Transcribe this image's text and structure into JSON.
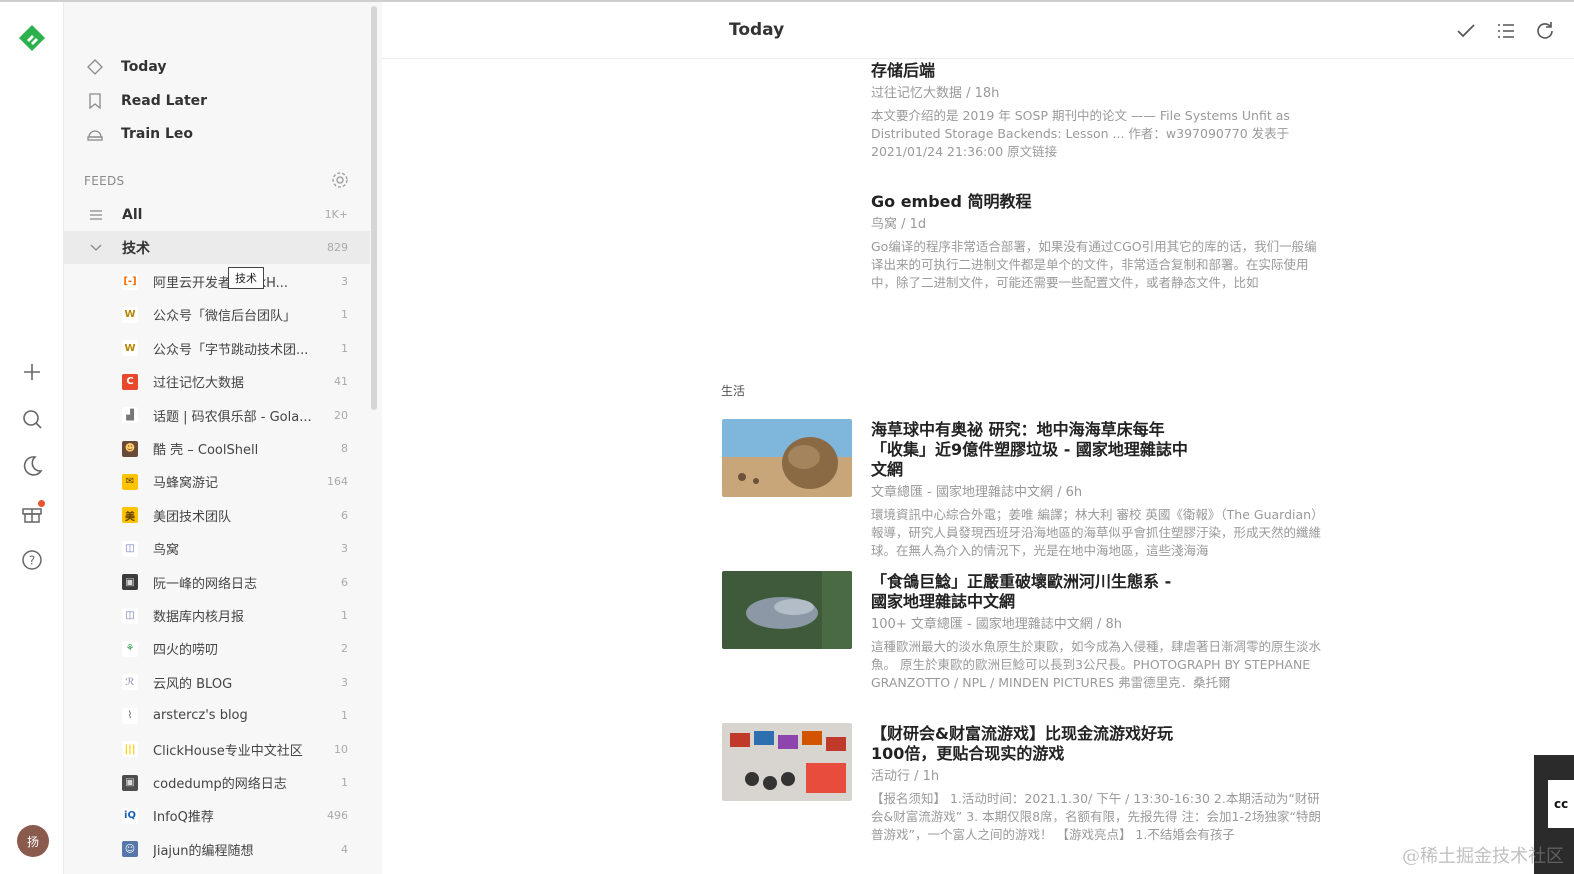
{
  "app": {
    "avatar_text": "扬"
  },
  "sidebar": {
    "nav": [
      {
        "label": "Today",
        "icon": "today-icon"
      },
      {
        "label": "Read Later",
        "icon": "bookmark-icon"
      },
      {
        "label": "Train Leo",
        "icon": "leo-icon"
      }
    ],
    "feeds_heading": "FEEDS",
    "all": {
      "label": "All",
      "count": "1K+"
    },
    "category": {
      "label": "技术",
      "count": "829"
    },
    "tooltip": "技术",
    "feeds": [
      {
        "label": "阿里云开发者 ClickH...",
        "count": "3",
        "icon_text": "[-]",
        "icon_bg": "#ffffff",
        "icon_fg": "#ff6a00"
      },
      {
        "label": "公众号「微信后台团队」",
        "count": "1",
        "icon_text": "W",
        "icon_bg": "#ffffff",
        "icon_fg": "#b38600"
      },
      {
        "label": "公众号「字节跳动技术团...",
        "count": "1",
        "icon_text": "W",
        "icon_bg": "#ffffff",
        "icon_fg": "#b38600"
      },
      {
        "label": "过往记忆大数据",
        "count": "41",
        "icon_text": "C",
        "icon_bg": "#e8482b",
        "icon_fg": "#ffffff"
      },
      {
        "label": "话题 | 码农俱乐部 - Gola...",
        "count": "20",
        "icon_text": "▟",
        "icon_bg": "#ffffff",
        "icon_fg": "#777777"
      },
      {
        "label": "酷 壳 – CoolShell",
        "count": "8",
        "icon_text": "☻",
        "icon_bg": "#6b4a3a",
        "icon_fg": "#ffcc66"
      },
      {
        "label": "马蜂窝游记",
        "count": "164",
        "icon_text": "✉",
        "icon_bg": "#ffc300",
        "icon_fg": "#5a3b00"
      },
      {
        "label": "美团技术团队",
        "count": "6",
        "icon_text": "美",
        "icon_bg": "#ffc300",
        "icon_fg": "#5a3b00"
      },
      {
        "label": "鸟窝",
        "count": "3",
        "icon_text": "◫",
        "icon_bg": "#ffffff",
        "icon_fg": "#6c7ab8"
      },
      {
        "label": "阮一峰的网络日志",
        "count": "6",
        "icon_text": "▣",
        "icon_bg": "#3b3b3b",
        "icon_fg": "#d9d9d9"
      },
      {
        "label": "数据库内核月报",
        "count": "1",
        "icon_text": "◫",
        "icon_bg": "#ffffff",
        "icon_fg": "#6c7ab8"
      },
      {
        "label": "四火的唠叨",
        "count": "2",
        "icon_text": "⚘",
        "icon_bg": "#ffffff",
        "icon_fg": "#2e9a4a"
      },
      {
        "label": "云风的 BLOG",
        "count": "3",
        "icon_text": "ℛ",
        "icon_bg": "#ffffff",
        "icon_fg": "#a0a8b8"
      },
      {
        "label": "arstercz's blog",
        "count": "1",
        "icon_text": "⌇",
        "icon_bg": "#ffffff",
        "icon_fg": "#888888"
      },
      {
        "label": "ClickHouse专业中文社区",
        "count": "10",
        "icon_text": "|||",
        "icon_bg": "#ffffff",
        "icon_fg": "#ffcc00"
      },
      {
        "label": "codedump的网络日志",
        "count": "1",
        "icon_text": "▣",
        "icon_bg": "#4d4d4d",
        "icon_fg": "#d9d9d9"
      },
      {
        "label": "InfoQ推荐",
        "count": "496",
        "icon_text": "iQ",
        "icon_bg": "#ffffff",
        "icon_fg": "#1b5fb0"
      },
      {
        "label": "Jiajun的编程随想",
        "count": "4",
        "icon_text": "☺",
        "icon_bg": "#5577aa",
        "icon_fg": "#ffffff"
      }
    ]
  },
  "main": {
    "title": "Today",
    "section_life": "生活",
    "articles": [
      {
        "title": "存储后端",
        "meta": "过往记忆大数据 / 18h",
        "snippet": "本文要介绍的是 2019 年 SOSP 期刊中的论文 —— File Systems Unfit as Distributed Storage Backends: Lesson ... 作者：w397090770 发表于 2021/01/24 21:36:00 原文链接"
      },
      {
        "title": "Go embed 简明教程",
        "meta": "鸟窝 / 1d",
        "snippet": "Go编译的程序非常适合部署，如果没有通过CGO引用其它的库的话，我们一般编译出来的可执行二进制文件都是单个的文件，非常适合复制和部署。在实际使用中，除了二进制文件，可能还需要一些配置文件，或者静态文件，比如"
      },
      {
        "title": "海草球中有奥祕 研究：地中海海草床每年「收集」近9億件塑膠垃圾 - 國家地理雜誌中文網",
        "meta": "文章總匯 - 國家地理雜誌中文網 / 6h",
        "snippet": "環境資訊中心綜合外電；姜唯 編譯；林大利 審校 英國《衛報》（The Guardian）報導，研究人員發現西班牙沿海地區的海草似乎會抓住塑膠汙染，形成天然的纖維球。在無人為介入的情況下，光是在地中海地區，這些淺海海"
      },
      {
        "title": "「食鴿巨鯰」正嚴重破壞歐洲河川生態系 - 國家地理雜誌中文網",
        "meta": "100+ 文章總匯 - 國家地理雜誌中文網 / 8h",
        "snippet": "這種歐洲最大的淡水魚原生於東歐，如今成為入侵種，肆虐著日漸凋零的原生淡水魚。 原生於東歐的歐洲巨鯰可以長到3公尺長。PHOTOGRAPH BY STEPHANE GRANZOTTO / NPL / MINDEN PICTURES 弗雷德里克．桑托爾"
      },
      {
        "title": "【财研会&财富流游戏】比现金流游戏好玩100倍，更贴合现实的游戏",
        "meta": "活动行 / 1h",
        "snippet": "【报名须知】 1.活动时间：2021.1.30/ 下午 / 13:30-16:30 2.本期活动为“财研会&财富流游戏” 3. 本期仅限8席，名额有限，先报先得 注：会加1-2场独家“特朗普游戏”，一个富人之间的游戏！ 【游戏亮点】 1.不结婚会有孩子"
      }
    ],
    "edge_tab_text": "cc"
  },
  "watermark": "@稀土掘金技术社区",
  "colors": {
    "brand": "#2bb24c",
    "rail_bg": "#ffffff",
    "sidebar_bg": "#f7f7f7",
    "active_row": "#ebebeb"
  }
}
